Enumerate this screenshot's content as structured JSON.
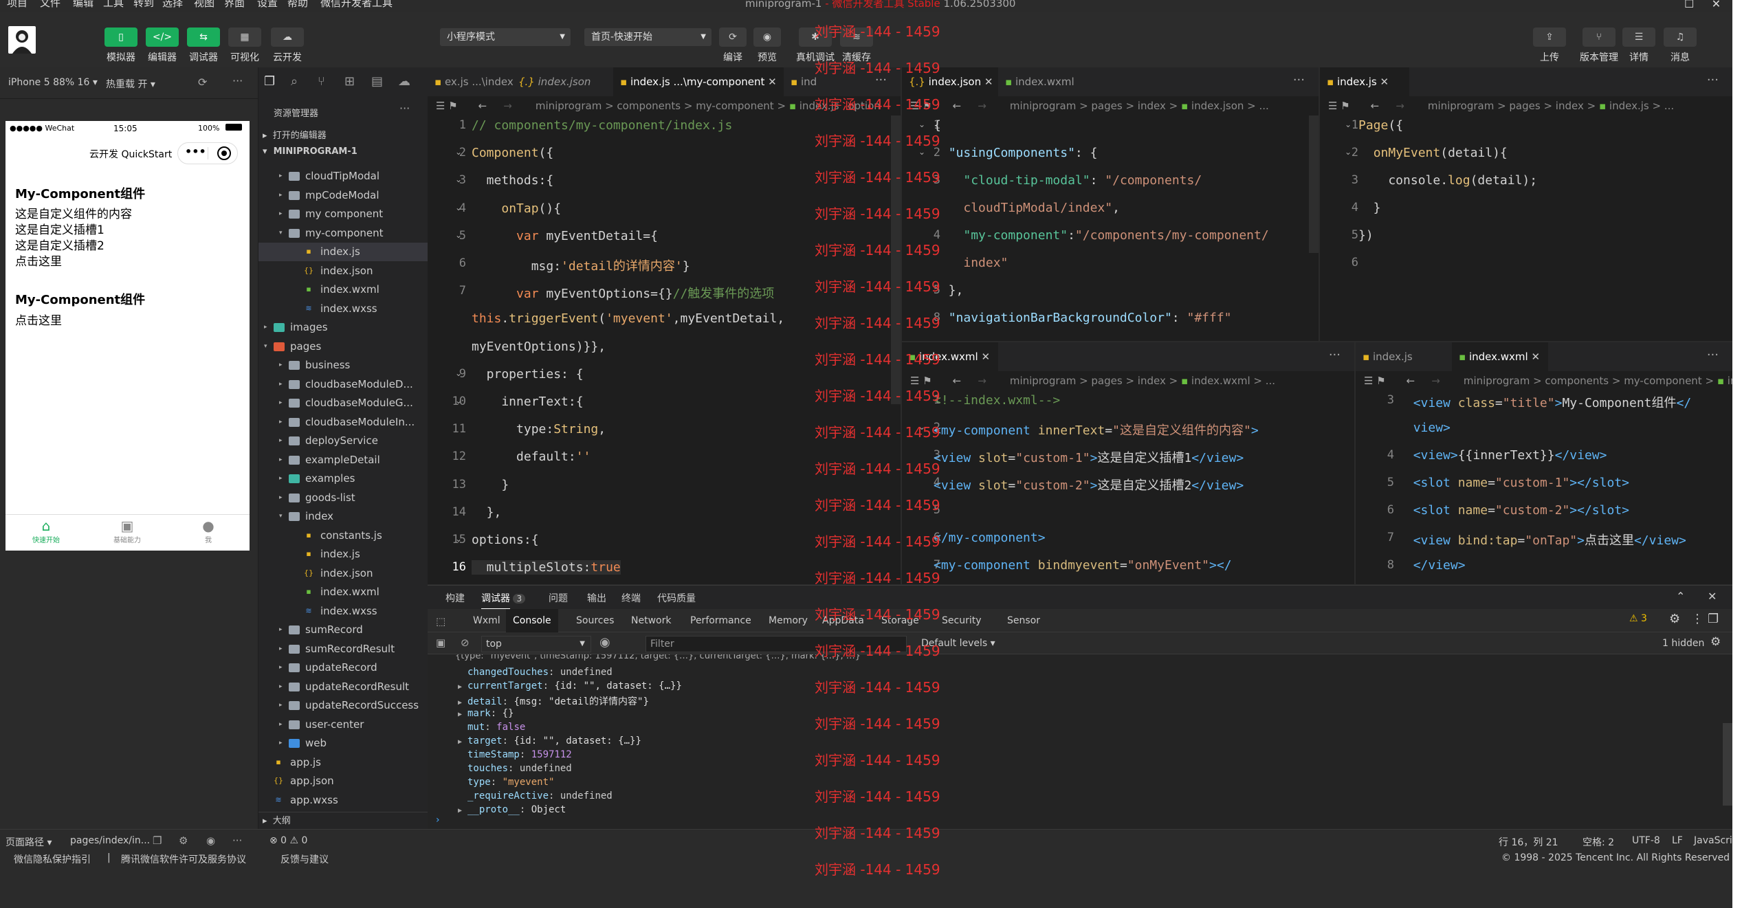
{
  "menu": [
    "项目",
    "文件",
    "编辑",
    "工具",
    "转到",
    "选择",
    "视图",
    "界面",
    "设置",
    "帮助",
    "微信开发者工具"
  ],
  "window_title": "miniprogram-1",
  "window_title_red": "- 微信开发者工具 Stable",
  "window_version": "1.06.2503300",
  "toolbar": {
    "simulator": "模拟器",
    "editor": "编辑器",
    "debugger": "调试器",
    "visual": "可视化",
    "cloud": "云开发",
    "mode": "小程序模式",
    "page": "首页-快速开始",
    "compile": "编译",
    "preview": "预览",
    "realdebug": "真机调试",
    "clearcache": "清缓存",
    "upload": "上传",
    "version": "版本管理",
    "details": "详情",
    "messages": "消息"
  },
  "sim": {
    "device": "iPhone 5 88% 16",
    "hotreload": "热重载 开",
    "status_carrier": "●●●●● WeChat",
    "status_time": "15:05",
    "status_batt": "100%",
    "nav_title": "云开发 QuickStart",
    "h1": "My-Component组件",
    "l1": "这是自定义组件的内容",
    "l2": "这是自定义插槽1",
    "l3": "这是自定义插槽2",
    "l4": "点击这里",
    "h2": "My-Component组件",
    "l5": "点击这里",
    "tabs": [
      "快速开始",
      "基础能力",
      "我"
    ]
  },
  "explorer": {
    "title": "资源管理器",
    "open_editors": "打开的编辑器",
    "project": "MINIPROGRAM-1",
    "outline": "大纲",
    "items": [
      {
        "t": "cloudTipModal",
        "lv": 2,
        "k": "folder"
      },
      {
        "t": "mpCodeModal",
        "lv": 2,
        "k": "folder"
      },
      {
        "t": "my component",
        "lv": 2,
        "k": "folder"
      },
      {
        "t": "my-component",
        "lv": 2,
        "k": "folder-open"
      },
      {
        "t": "index.js",
        "lv": 3,
        "k": "js",
        "sel": true
      },
      {
        "t": "index.json",
        "lv": 3,
        "k": "json"
      },
      {
        "t": "index.wxml",
        "lv": 3,
        "k": "wxml"
      },
      {
        "t": "index.wxss",
        "lv": 3,
        "k": "wxss"
      },
      {
        "t": "images",
        "lv": 1,
        "k": "folder-img"
      },
      {
        "t": "pages",
        "lv": 1,
        "k": "folder-pages"
      },
      {
        "t": "business",
        "lv": 2,
        "k": "folder"
      },
      {
        "t": "cloudbaseModuleD...",
        "lv": 2,
        "k": "folder"
      },
      {
        "t": "cloudbaseModuleG...",
        "lv": 2,
        "k": "folder"
      },
      {
        "t": "cloudbaseModuleIn...",
        "lv": 2,
        "k": "folder"
      },
      {
        "t": "deployService",
        "lv": 2,
        "k": "folder"
      },
      {
        "t": "exampleDetail",
        "lv": 2,
        "k": "folder"
      },
      {
        "t": "examples",
        "lv": 2,
        "k": "folder-ex"
      },
      {
        "t": "goods-list",
        "lv": 2,
        "k": "folder"
      },
      {
        "t": "index",
        "lv": 2,
        "k": "folder-open"
      },
      {
        "t": "constants.js",
        "lv": 3,
        "k": "js"
      },
      {
        "t": "index.js",
        "lv": 3,
        "k": "js"
      },
      {
        "t": "index.json",
        "lv": 3,
        "k": "json"
      },
      {
        "t": "index.wxml",
        "lv": 3,
        "k": "wxml"
      },
      {
        "t": "index.wxss",
        "lv": 3,
        "k": "wxss"
      },
      {
        "t": "sumRecord",
        "lv": 2,
        "k": "folder"
      },
      {
        "t": "sumRecordResult",
        "lv": 2,
        "k": "folder"
      },
      {
        "t": "updateRecord",
        "lv": 2,
        "k": "folder"
      },
      {
        "t": "updateRecordResult",
        "lv": 2,
        "k": "folder"
      },
      {
        "t": "updateRecordSuccess",
        "lv": 2,
        "k": "folder"
      },
      {
        "t": "user-center",
        "lv": 2,
        "k": "folder"
      },
      {
        "t": "web",
        "lv": 2,
        "k": "folder-web"
      },
      {
        "t": "app.js",
        "lv": 1,
        "k": "js"
      },
      {
        "t": "app.json",
        "lv": 1,
        "k": "json"
      },
      {
        "t": "app.wxss",
        "lv": 1,
        "k": "wxss"
      }
    ]
  },
  "editor1": {
    "tabs": [
      "ex.js ...\\index",
      "index.json",
      "index.js ...\\my-component",
      "ind"
    ],
    "breadcrumb": "miniprogram  >  components  >  my-component  >",
    "bc_file": "index.js",
    "bc_tail": "option",
    "lines": [
      {
        "n": "1",
        "h": "<span class='cm'>// components/my-component/index.js</span>"
      },
      {
        "n": "2",
        "h": "<span class='fn'>Component</span>({"
      },
      {
        "n": "3",
        "h": "  methods:{"
      },
      {
        "n": "4",
        "h": "    <span class='fn'>onTap</span>(){"
      },
      {
        "n": "5",
        "h": "      <span class='kw'>var</span> myEventDetail={"
      },
      {
        "n": "6",
        "h": "        msg:<span class='str'>'detail的详情内容'</span>}"
      },
      {
        "n": "7",
        "h": "      <span class='kw'>var</span> myEventOptions={}<span class='cm'>//触发事件的选项</span>"
      },
      {
        "n": "",
        "h": "<span class='kw'>this</span>.<span class='fn'>triggerEvent</span>(<span class='str'>'myevent'</span>,myEventDetail,"
      },
      {
        "n": "",
        "h": "myEventOptions)}},"
      },
      {
        "n": "9",
        "h": "  properties: {"
      },
      {
        "n": "10",
        "h": "    innerText:{"
      },
      {
        "n": "11",
        "h": "      type:<span class='fn'>String</span>,"
      },
      {
        "n": "12",
        "h": "      default:<span class='str'>''</span>"
      },
      {
        "n": "13",
        "h": "    }"
      },
      {
        "n": "14",
        "h": "  },"
      },
      {
        "n": "15",
        "h": "options:{"
      },
      {
        "n": "16",
        "h": "  multipleSlots:<span class='kw'>true</span>"
      }
    ]
  },
  "editor2": {
    "tabs": [
      "index.json",
      "index.wxml"
    ],
    "breadcrumb": "miniprogram  >  pages  >  index  >",
    "bc_file": "index.json  > ...",
    "lines": [
      {
        "n": "1",
        "h": "{"
      },
      {
        "n": "2",
        "h": "  <span class='prop'>\"usingComponents\"</span>: {"
      },
      {
        "n": "3",
        "h": "    <span class='cc'>\"cloud-tip-modal\"</span>: <span class='sv'>\"/components/</span>"
      },
      {
        "n": "",
        "h": "    <span class='sv'>cloudTipModal/index\"</span>,"
      },
      {
        "n": "4",
        "h": "    <span class='cc'>\"my-component\"</span>:<span class='sv'>\"/components/my-component/</span>"
      },
      {
        "n": "",
        "h": "    <span class='sv'>index\"</span>"
      },
      {
        "n": "5",
        "h": "  },"
      },
      {
        "n": "8",
        "h": "  <span class='prop'>\"navigationBarBackgroundColor\"</span>: <span class='sv'>\"#fff\"</span>"
      }
    ]
  },
  "editor3": {
    "tabs": [
      "index.js"
    ],
    "breadcrumb": "miniprogram  >  pages  >  index  >",
    "bc_file": "index.js  > ...",
    "lines": [
      {
        "n": "1",
        "h": "<span class='fn'>Page</span>({"
      },
      {
        "n": "2",
        "h": "  <span class='fn'>onMyEvent</span>(detail){"
      },
      {
        "n": "3",
        "h": "    console.<span class='fn'>log</span>(detail);"
      },
      {
        "n": "4",
        "h": "  }"
      },
      {
        "n": "5",
        "h": "})"
      },
      {
        "n": "6",
        "h": ""
      }
    ]
  },
  "editor4": {
    "tabs": [
      "index.wxml"
    ],
    "breadcrumb": "miniprogram  >  pages  >  index  >",
    "bc_file": "index.wxml  > ...",
    "lines": [
      {
        "n": "1",
        "h": "<span class='cm'>&lt;!--index.wxml--&gt;</span>"
      },
      {
        "n": "2",
        "h": "<span class='tag'>&lt;my-component</span> <span class='attr'>innerText</span>=<span class='sv'>\"这是自定义组件的内容\"</span><span class='tag'>&gt;</span>"
      },
      {
        "n": "3",
        "h": "<span class='tag'>&lt;view</span> <span class='attr'>slot</span>=<span class='sv'>\"custom-1\"</span><span class='tag'>&gt;</span>这是自定义插槽1<span class='tag'>&lt;/view&gt;</span>"
      },
      {
        "n": "4",
        "h": "<span class='tag'>&lt;view</span> <span class='attr'>slot</span>=<span class='sv'>\"custom-2\"</span><span class='tag'>&gt;</span>这是自定义插槽2<span class='tag'>&lt;/view&gt;</span>"
      },
      {
        "n": "5",
        "h": ""
      },
      {
        "n": "6",
        "h": "<span class='tag'>&lt;/my-component&gt;</span>"
      },
      {
        "n": "7",
        "h": "<span class='tag'>&lt;my-component</span> <span class='attr'>bindmyevent</span>=<span class='sv'>\"onMyEvent\"</span><span class='tag'>&gt;&lt;/</span>"
      }
    ]
  },
  "editor5": {
    "tabs": [
      "index.js",
      "index.wxml"
    ],
    "breadcrumb": "miniprogram  >  components  >  my-component  >",
    "bc_file": "ind",
    "lines": [
      {
        "n": "3",
        "h": "  <span class='tag'>&lt;view</span> <span class='attr'>class</span>=<span class='sv'>\"title\"</span><span class='tag'>&gt;</span>My-Component组件<span class='tag'>&lt;/</span>"
      },
      {
        "n": "",
        "h": "  <span class='tag'>view&gt;</span>"
      },
      {
        "n": "4",
        "h": "  <span class='tag'>&lt;view&gt;</span>{{innerText}}<span class='tag'>&lt;/view&gt;</span>"
      },
      {
        "n": "5",
        "h": "  <span class='tag'>&lt;slot</span> <span class='attr'>name</span>=<span class='sv'>\"custom-1\"</span><span class='tag'>&gt;&lt;/slot&gt;</span>"
      },
      {
        "n": "6",
        "h": "  <span class='tag'>&lt;slot</span> <span class='attr'>name</span>=<span class='sv'>\"custom-2\"</span><span class='tag'>&gt;&lt;/slot&gt;</span>"
      },
      {
        "n": "7",
        "h": "  <span class='tag'>&lt;view</span> <span class='attr'>bind:tap</span>=<span class='sv'>\"onTap\"</span><span class='tag'>&gt;</span>点击这里<span class='tag'>&lt;/view&gt;</span>"
      },
      {
        "n": "8",
        "h": "  <span class='tag'>&lt;/view&gt;</span>"
      }
    ]
  },
  "devtools": {
    "tabs": [
      "构建",
      "调试器",
      "问题",
      "输出",
      "终端",
      "代码质量"
    ],
    "badge": "3",
    "panels": [
      "Wxml",
      "Console",
      "Sources",
      "Network",
      "Performance",
      "Memory",
      "AppData",
      "Storage",
      "Security",
      "Sensor"
    ],
    "warn_count": "3",
    "context": "top",
    "filter_placeholder": "Filter",
    "levels": "Default levels",
    "hidden": "1 hidden",
    "console": [
      {
        "a": "",
        "k": "changedTouches",
        "v": "undefined",
        "c": "#ccc"
      },
      {
        "a": "▶",
        "k": "currentTarget",
        "v": "{id: \"\", dataset: {…}}",
        "c": "#ddd"
      },
      {
        "a": "▶",
        "k": "detail",
        "v": "{msg: \"detail的详情内容\"}",
        "c": "#ddd"
      },
      {
        "a": "▶",
        "k": "mark",
        "v": "{}",
        "c": "#ddd"
      },
      {
        "a": "",
        "k": "mut",
        "v": "false",
        "c": "#c792ea"
      },
      {
        "a": "▶",
        "k": "target",
        "v": "{id: \"\", dataset: {…}}",
        "c": "#ddd"
      },
      {
        "a": "",
        "k": "timeStamp",
        "v": "1597112",
        "c": "#c792ea"
      },
      {
        "a": "",
        "k": "touches",
        "v": "undefined",
        "c": "#ccc"
      },
      {
        "a": "",
        "k": "type",
        "v": "\"myevent\"",
        "c": "#e9a86a"
      },
      {
        "a": "",
        "k": "_requireActive",
        "v": "undefined",
        "c": "#ccc"
      },
      {
        "a": "▶",
        "k": "__proto__",
        "v": "Object",
        "c": "#ddd"
      }
    ]
  },
  "status": {
    "pagepath_label": "页面路径",
    "pagepath": "pages/index/in...",
    "errors": "⊗ 0 ⚠ 0",
    "pos": "行 16，列 21",
    "spaces": "空格: 2",
    "enc": "UTF-8",
    "eol": "LF",
    "lang": "JavaScript"
  },
  "footer": {
    "links": [
      "微信隐私保护指引",
      "|",
      "腾讯微信软件许可及服务协议",
      "反馈与建议"
    ],
    "copyright": "© 1998 - 2025 Tencent Inc. All Rights Reserved"
  },
  "watermark": "刘宇涵 -144 - 1459"
}
